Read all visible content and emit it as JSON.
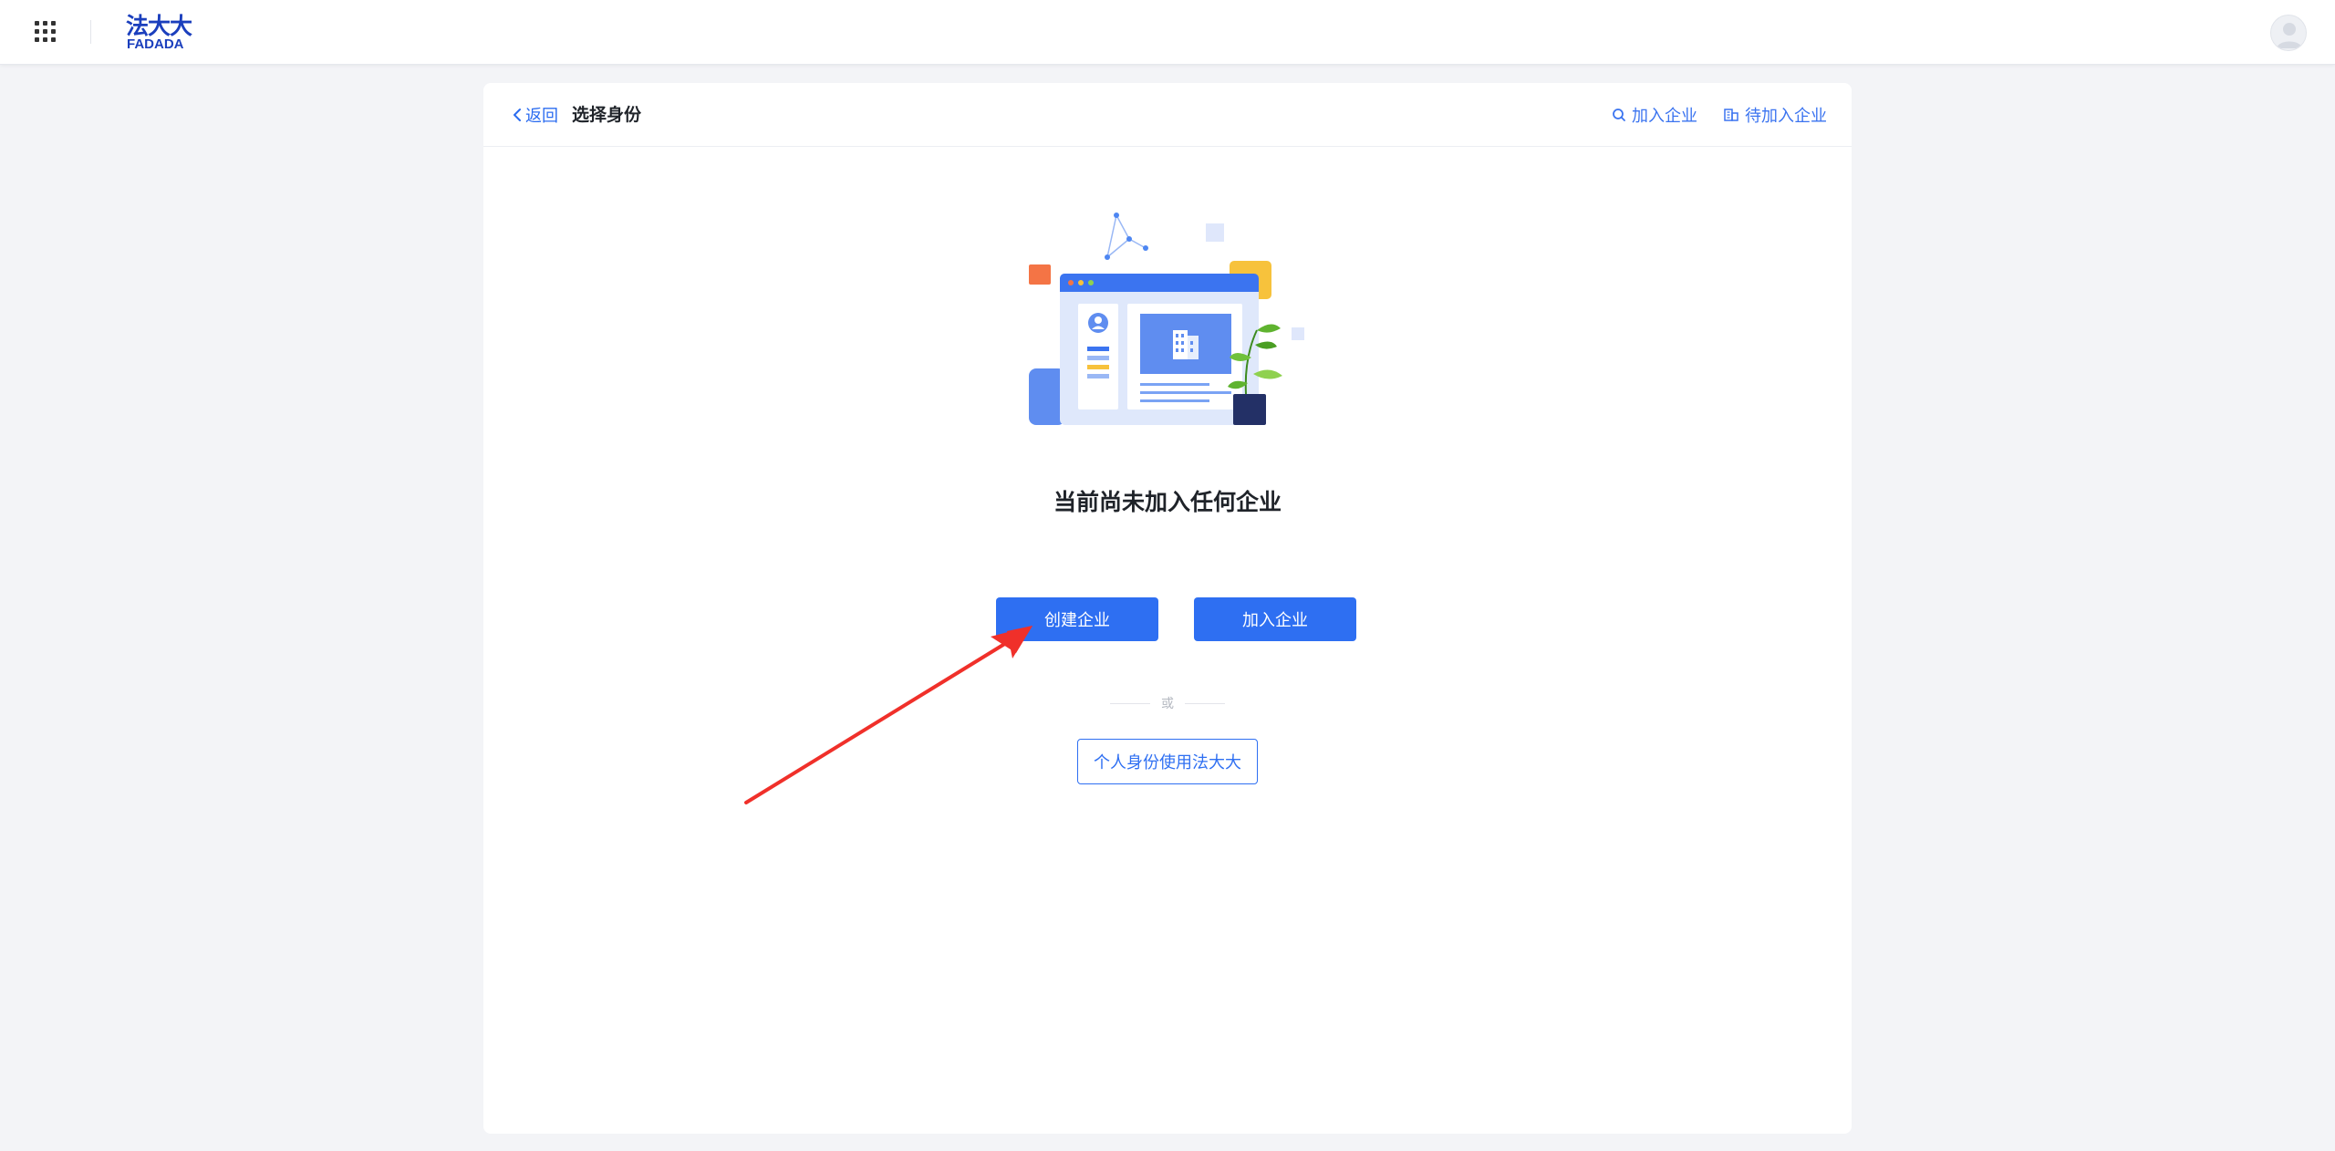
{
  "topbar": {
    "logo_cn": "法大大",
    "logo_en": "FADADA",
    "apps_icon": "grid-icon",
    "avatar_icon": "user-avatar-icon"
  },
  "header": {
    "back_label": "返回",
    "title": "选择身份",
    "join_label": "加入企业",
    "pending_label": "待加入企业"
  },
  "main": {
    "empty_title": "当前尚未加入任何企业",
    "create_button": "创建企业",
    "join_button": "加入企业",
    "or_text": "或",
    "personal_button": "个人身份使用法大大"
  },
  "colors": {
    "primary": "#2e6ff2",
    "brand": "#1b3fbd",
    "annotation": "#f0302a"
  }
}
